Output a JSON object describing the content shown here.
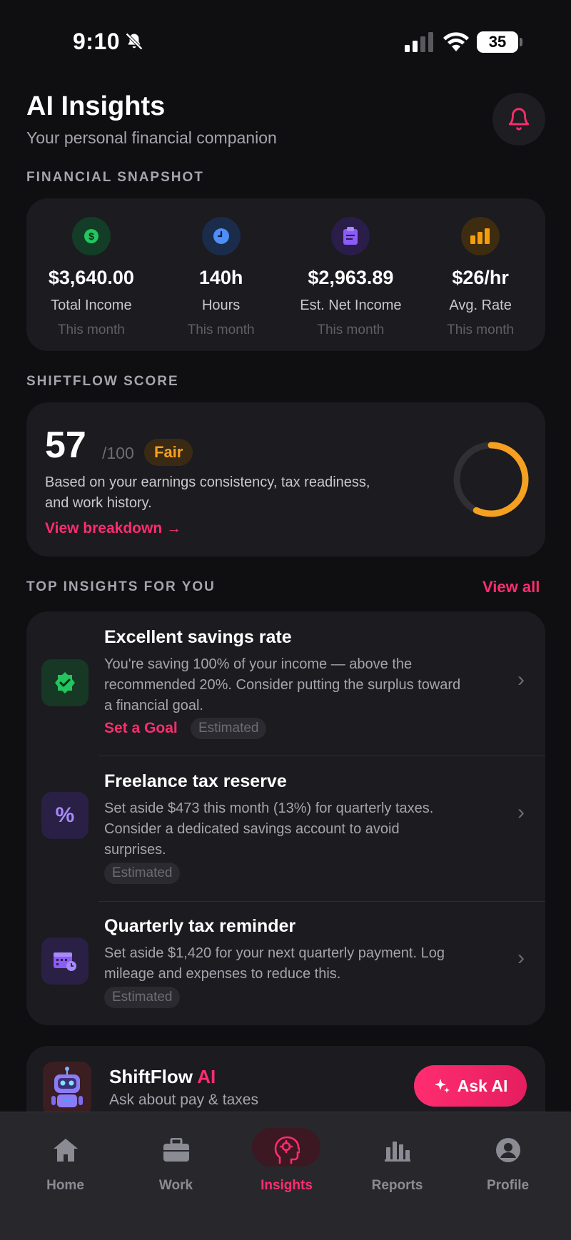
{
  "status_bar": {
    "time": "9:10",
    "battery": "35"
  },
  "header": {
    "title": "AI Insights",
    "subtitle": "Your personal financial companion",
    "icons": {
      "notifications": "bell-icon"
    }
  },
  "snapshot": {
    "label": "FINANCIAL SNAPSHOT",
    "stats": [
      {
        "value": "$3,640.00",
        "label": "Total Income",
        "period": "This month",
        "icon": "dollar-icon",
        "color": "#22c55e"
      },
      {
        "value": "140h",
        "label": "Hours",
        "period": "This month",
        "icon": "clock-icon",
        "color": "#3b82f6"
      },
      {
        "value": "$2,963.89",
        "label": "Est. Net Income",
        "period": "This month",
        "icon": "clipboard-icon",
        "color": "#7c3aed"
      },
      {
        "value": "$26/hr",
        "label": "Avg. Rate",
        "period": "This month",
        "icon": "bar-chart-icon",
        "color": "#f59e0b"
      }
    ]
  },
  "score": {
    "label": "SHIFTFLOW SCORE",
    "value": "57",
    "max": "/100",
    "rating": "Fair",
    "progress": 0.57,
    "description": "Based on your earnings consistency, tax readiness, and work history.",
    "link": "View breakdown →"
  },
  "insights": {
    "label": "TOP INSIGHTS FOR YOU",
    "view_all": "View all",
    "items": [
      {
        "title": "Excellent savings rate",
        "body": "You're saving 100% of your income — above the recommended 20%. Consider putting the surplus toward a financial goal.",
        "action": "Set a Goal",
        "tag": "Estimated",
        "icon": "verified-badge-icon"
      },
      {
        "title": "Freelance tax reserve",
        "body": "Set aside $473 this month (13%) for quarterly taxes. Consider a dedicated savings account to avoid surprises.",
        "tag": "Estimated",
        "icon": "percent-icon"
      },
      {
        "title": "Quarterly tax reminder",
        "body": "Set aside $1,420 for your next quarterly payment. Log mileage and expenses to reduce this.",
        "tag": "Estimated",
        "icon": "calendar-clock-icon"
      }
    ]
  },
  "ai": {
    "title_main": "ShiftFlow ",
    "title_accent": "AI",
    "subtitle": "Ask about pay & taxes",
    "button": "Ask AI"
  },
  "tabs": [
    {
      "label": "Home",
      "icon": "home-icon"
    },
    {
      "label": "Work",
      "icon": "briefcase-icon"
    },
    {
      "label": "Insights",
      "icon": "brain-icon",
      "active": true
    },
    {
      "label": "Reports",
      "icon": "bar-chart-icon"
    },
    {
      "label": "Profile",
      "icon": "user-icon"
    }
  ],
  "colors": {
    "accent": "#ff2d6f",
    "background": "#0f0f12",
    "card": "#1b1b20",
    "fair": "#f5a020"
  }
}
